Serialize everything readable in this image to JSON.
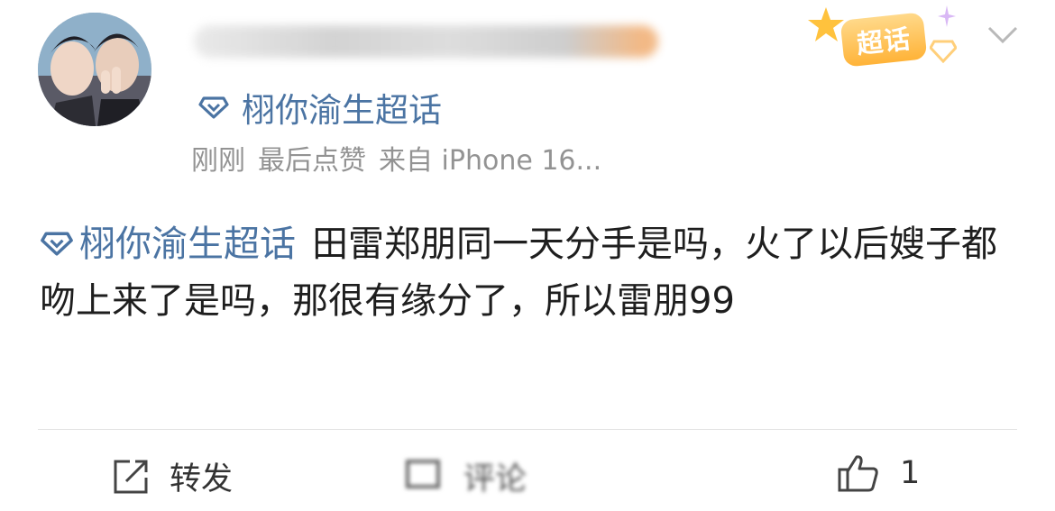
{
  "post": {
    "topic_name": "栩你渝生超话",
    "time": "刚刚",
    "liked_note": "最后点赞",
    "source": "来自 iPhone 16...",
    "body": "田雷郑朋同一天分手是吗，火了以后嫂子都吻上来了是吗，那很有缘分了，所以雷朋99"
  },
  "badge": {
    "label": "超话"
  },
  "actions": {
    "repost_label": "转发",
    "comment_label": "评论",
    "like_count": "1"
  },
  "colors": {
    "topic_blue": "#4b74a3",
    "badge_orange": "#ffb338",
    "meta_gray": "#939393"
  },
  "icons": [
    "diamond-icon",
    "chevron-down-icon",
    "repost-icon",
    "comment-icon",
    "thumbs-up-icon",
    "star-icon",
    "sparkle-icon"
  ]
}
